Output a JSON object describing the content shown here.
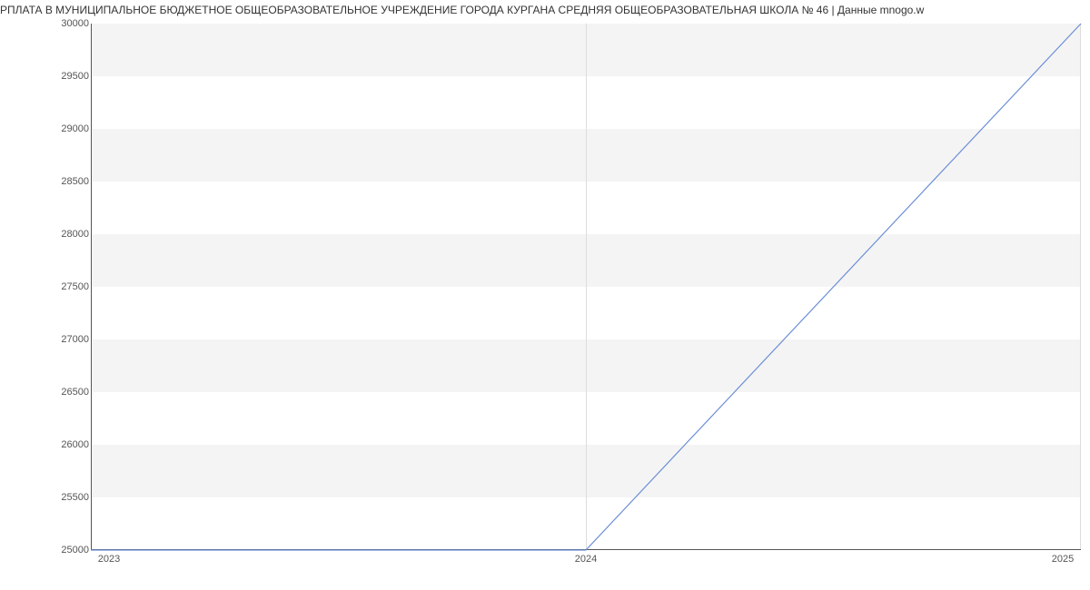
{
  "title": "РПЛАТА В МУНИЦИПАЛЬНОЕ БЮДЖЕТНОЕ ОБЩЕОБРАЗОВАТЕЛЬНОЕ УЧРЕЖДЕНИЕ ГОРОДА КУРГАНА СРЕДНЯЯ ОБЩЕОБРАЗОВАТЕЛЬНАЯ ШКОЛА № 46 | Данные mnogo.w",
  "chart_data": {
    "type": "line",
    "x": [
      2023,
      2024,
      2025
    ],
    "values": [
      25000,
      25000,
      30000
    ],
    "xlim": [
      2023,
      2025
    ],
    "ylim": [
      25000,
      30000
    ],
    "y_ticks": [
      25000,
      25500,
      26000,
      26500,
      27000,
      27500,
      28000,
      28500,
      29000,
      29500,
      30000
    ],
    "x_ticks": [
      2023,
      2024,
      2025
    ],
    "line_color": "#6b8fd6"
  }
}
